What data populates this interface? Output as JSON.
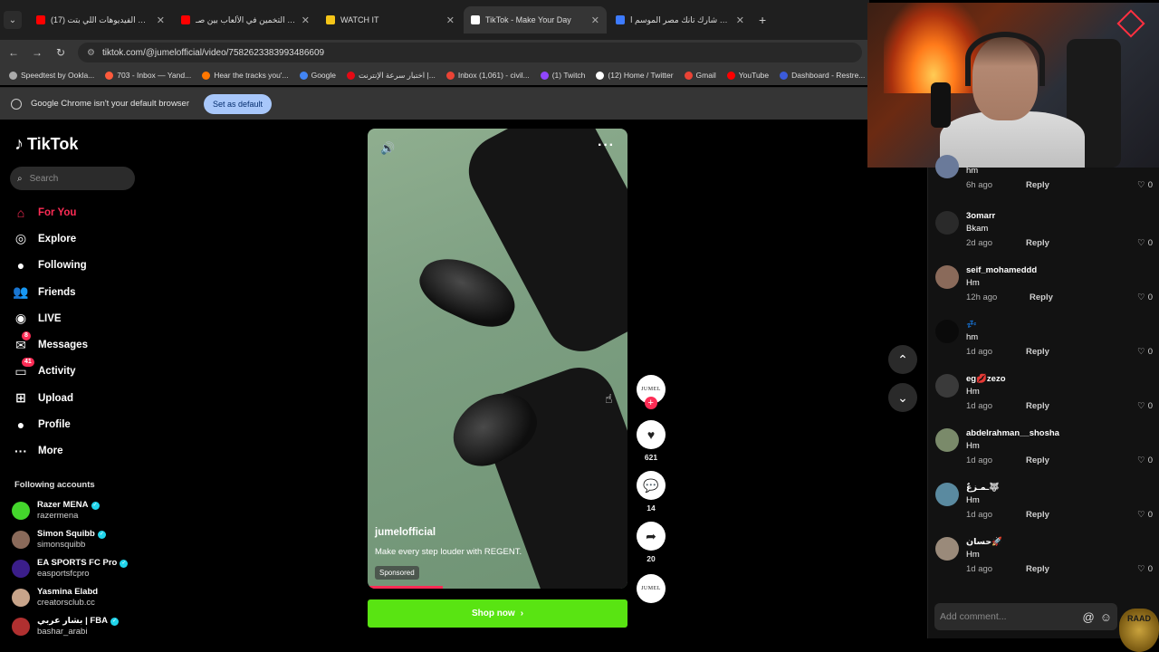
{
  "browser": {
    "tabs": [
      {
        "title": "(17) هي دي الفيديوهات اللي بتت...",
        "favicon_color": "#ff0000",
        "icon": "youtube-icon"
      },
      {
        "title": "تحدي التخمين في الألعاب بين صـ...",
        "favicon_color": "#ff0000",
        "icon": "youtube-icon"
      },
      {
        "title": "WATCH IT",
        "favicon_color": "#f5c518",
        "icon": "watchit-icon"
      },
      {
        "title": "TikTok - Make Your Day",
        "favicon_color": "#ffffff",
        "icon": "tiktok-icon",
        "active": true
      },
      {
        "title": "برنامج شارك تانك مصر الموسم ا...",
        "favicon_color": "#3d7bff",
        "icon": "play-icon"
      }
    ],
    "url": "tiktok.com/@jumelofficial/video/7582623383993486609",
    "bookmarks": [
      {
        "label": "Speedtest by Ookla...",
        "color": "#aaaaaa"
      },
      {
        "label": "703 - Inbox — Yand...",
        "color": "#ff5a3c"
      },
      {
        "label": "Hear the tracks you'...",
        "color": "#ff7700"
      },
      {
        "label": "Google",
        "color": "#4285f4"
      },
      {
        "label": "اختبار سرعة الإنترنت |...",
        "color": "#e50914"
      },
      {
        "label": "Inbox (1,061) - civil...",
        "color": "#ea4335"
      },
      {
        "label": "(1) Twitch",
        "color": "#9146ff"
      },
      {
        "label": "(12) Home / Twitter",
        "color": "#ffffff"
      },
      {
        "label": "Gmail",
        "color": "#ea4335"
      },
      {
        "label": "YouTube",
        "color": "#ff0000"
      },
      {
        "label": "Dashboard - Restre...",
        "color": "#3b5bdb"
      }
    ],
    "infobar_text": "Google Chrome isn't your default browser",
    "infobar_button": "Set as default"
  },
  "sidebar": {
    "logo": "TikTok",
    "search_placeholder": "Search",
    "nav": [
      {
        "label": "For You",
        "icon": "home-icon",
        "active": true
      },
      {
        "label": "Explore",
        "icon": "compass-icon"
      },
      {
        "label": "Following",
        "icon": "following-avatar-icon"
      },
      {
        "label": "Friends",
        "icon": "friends-icon"
      },
      {
        "label": "LIVE",
        "icon": "live-icon"
      },
      {
        "label": "Messages",
        "icon": "messages-icon",
        "badge": "8"
      },
      {
        "label": "Activity",
        "icon": "activity-icon",
        "badge": "41"
      },
      {
        "label": "Upload",
        "icon": "upload-icon"
      },
      {
        "label": "Profile",
        "icon": "profile-avatar-icon"
      },
      {
        "label": "More",
        "icon": "more-icon"
      }
    ],
    "following_title": "Following accounts",
    "following": [
      {
        "name": "Razer MENA",
        "user": "razermena",
        "verified": true,
        "color": "#44d62c"
      },
      {
        "name": "Simon Squibb",
        "user": "simonsquibb",
        "verified": true,
        "color": "#8a6a5a"
      },
      {
        "name": "EA SPORTS FC Pro",
        "user": "easportsfcpro",
        "verified": true,
        "color": "#3b1e8a"
      },
      {
        "name": "Yasmina Elabd",
        "user": "creatorsclub.cc",
        "verified": false,
        "color": "#c8a48a"
      },
      {
        "name": "بشار عربي | FBA",
        "user": "bashar_arabi",
        "verified": true,
        "color": "#b03030"
      }
    ]
  },
  "video": {
    "author": "jumelofficial",
    "description": "Make every step louder with REGENT.",
    "sponsored": "Sponsored",
    "progress": 0.29,
    "shop_label": "Shop now",
    "avatar_text": "JUMEL",
    "likes": "621",
    "comments": "14",
    "shares": "20"
  },
  "comments": [
    {
      "name": "",
      "text": "hm",
      "time": "6h ago",
      "likes": "0",
      "color": "#6a7a9a"
    },
    {
      "name": "3omarr",
      "text": "Bkam",
      "time": "2d ago",
      "likes": "0",
      "color": "#2a2a2a"
    },
    {
      "name": "seif_mohameddd",
      "text": "Hm",
      "time": "12h ago",
      "likes": "0",
      "color": "#8a6a5a"
    },
    {
      "name": "💤",
      "text": "hm",
      "time": "1d ago",
      "likes": "0",
      "color": "#0a0a0a"
    },
    {
      "name": "eg💋zezo",
      "text": "Hm",
      "time": "1d ago",
      "likes": "0",
      "color": "#3a3a3a"
    },
    {
      "name": "abdelrahman__shosha",
      "text": "Hm",
      "time": "1d ago",
      "likes": "0",
      "color": "#7a8a6a"
    },
    {
      "name": "ـمـزعٌ🐺",
      "text": "Hm",
      "time": "1d ago",
      "likes": "0",
      "color": "#5a8aa0"
    },
    {
      "name": "حسان🚀",
      "text": "Hm",
      "time": "1d ago",
      "likes": "0",
      "color": "#9a8a7a"
    }
  ],
  "comment_reply_label": "Reply",
  "add_comment_placeholder": "Add comment...",
  "overlay_badge": "RAAD"
}
